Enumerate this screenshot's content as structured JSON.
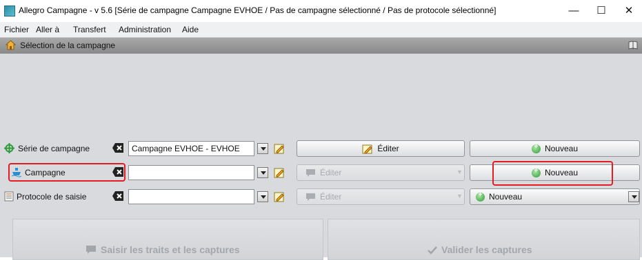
{
  "window": {
    "title": "Allegro Campagne - v 5.6 [Série de campagne Campagne EVHOE / Pas de campagne sélectionné / Pas de protocole sélectionné]",
    "minimize": "—",
    "maximize": "☐",
    "close": "✕"
  },
  "menu": {
    "items": [
      "Fichier",
      "Aller à",
      "Transfert",
      "Administration",
      "Aide"
    ]
  },
  "panel": {
    "title": "Sélection de la campagne"
  },
  "rows": {
    "serie": {
      "label": "Série de campagne",
      "value": "Campagne EVHOE - EVHOE",
      "edit_label": "Éditer",
      "new_label": "Nouveau"
    },
    "campagne": {
      "label": "Campagne",
      "value": "",
      "edit_label": "Éditer",
      "new_label": "Nouveau"
    },
    "protocole": {
      "label": "Protocole de saisie",
      "value": "",
      "edit_label": "Éditer",
      "new_label": "Nouveau"
    }
  },
  "actions": {
    "saisir": "Saisir les traits et les captures",
    "valider": "Valider les captures"
  },
  "colors": {
    "highlight": "#e31b23",
    "panel_header": "#9a9a9a",
    "main_bg": "#d8dade"
  }
}
